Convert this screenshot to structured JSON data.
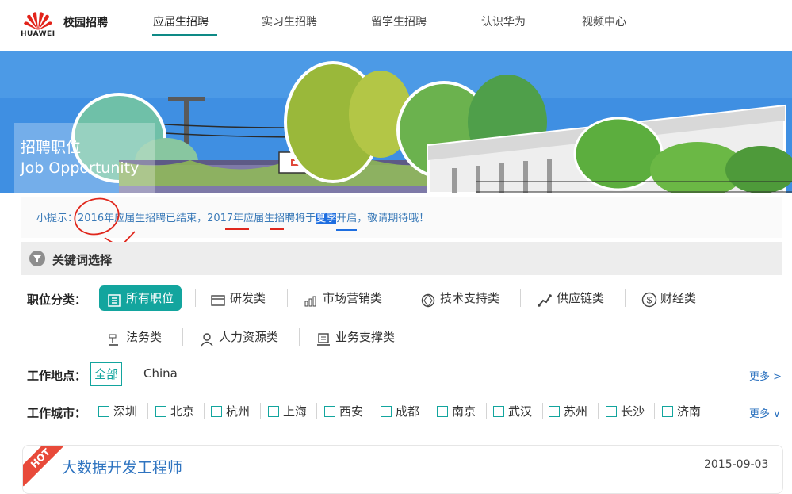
{
  "header": {
    "logo_text": "HUAWEI",
    "site_title": "校园招聘",
    "nav": [
      {
        "label": "应届生招聘",
        "active": true
      },
      {
        "label": "实习生招聘"
      },
      {
        "label": "留学生招聘"
      },
      {
        "label": "认识华为"
      },
      {
        "label": "视频中心"
      }
    ]
  },
  "banner": {
    "title_cn": "招聘职位",
    "title_en": "Job Opportunity"
  },
  "tip": {
    "prefix": "小提示：",
    "part1": "2016年应届生招聘已结束，2017年应届生招聘将于",
    "highlight": "夏季",
    "part2": "开启，敬请期待哦！"
  },
  "keyword": {
    "label": "关键词选择"
  },
  "categories": {
    "label": "职位分类：",
    "items": [
      "所有职位",
      "研发类",
      "市场营销类",
      "技术支持类",
      "供应链类",
      "财经类",
      "法务类",
      "人力资源类",
      "业务支撑类"
    ]
  },
  "location": {
    "label": "工作地点：",
    "all": "全部",
    "country": "China",
    "more": "更多 >"
  },
  "city": {
    "label": "工作城市：",
    "items": [
      "深圳",
      "北京",
      "杭州",
      "上海",
      "西安",
      "成都",
      "南京",
      "武汉",
      "苏州",
      "长沙",
      "济南"
    ],
    "more": "更多 ∨"
  },
  "job": {
    "badge": "HOT",
    "title": "大数据开发工程师",
    "date": "2015-09-03"
  },
  "colors": {
    "accent": "#13a59e",
    "link": "#2f74c0",
    "brand": "#e2231a"
  }
}
